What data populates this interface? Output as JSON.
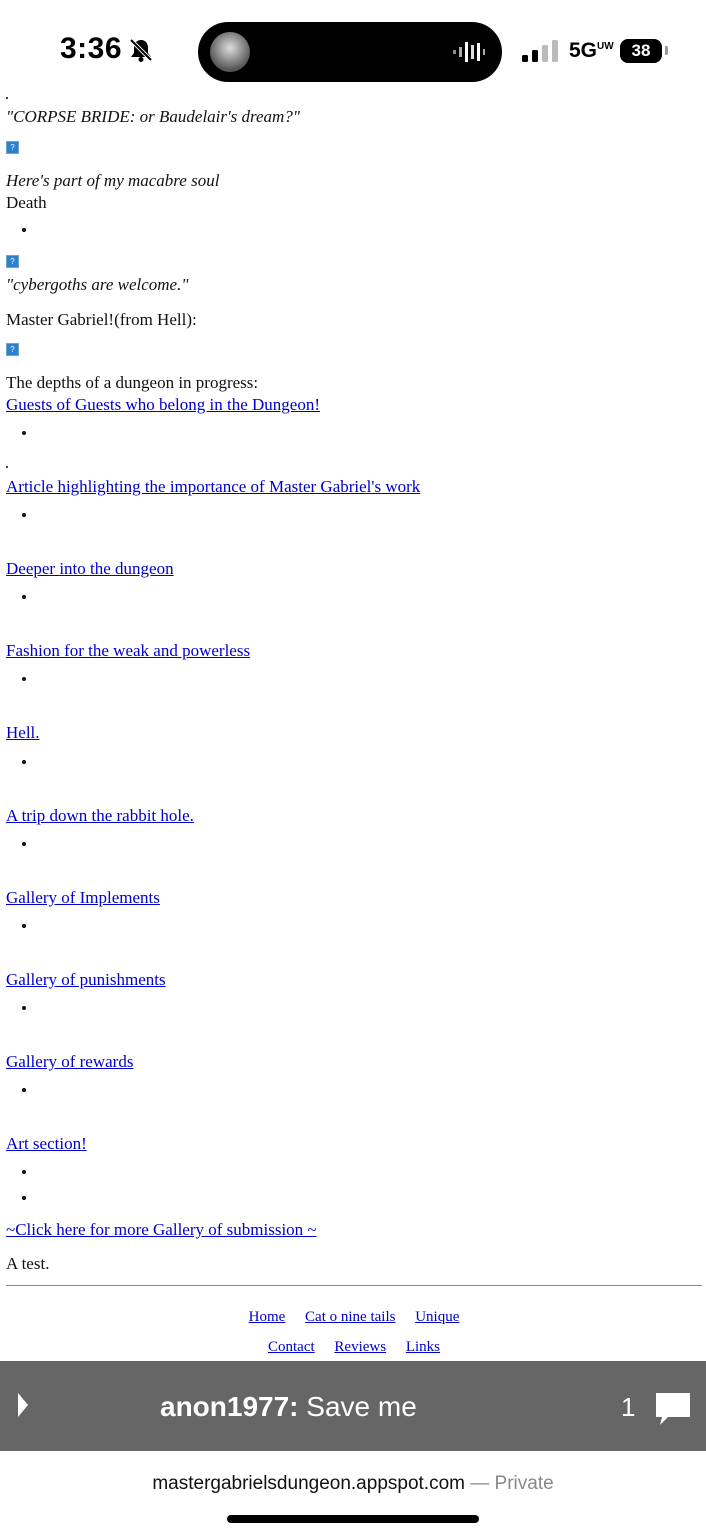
{
  "status_bar": {
    "time": "3:36",
    "network": "5G",
    "network_superscript": "UW",
    "battery": "38"
  },
  "content": {
    "corpse_bride": "\"CORPSE BRIDE: or Baudelair's dream?\"",
    "macabre_soul": "Here's part of my macabre soul",
    "death": "Death",
    "cybergoths": "\"cybergoths are welcome.\"",
    "master_gabriel": "Master Gabriel!(from Hell):",
    "dungeon_progress": "The depths of a dungeon in progress:",
    "links": [
      "Guests of Guests who belong in the Dungeon!",
      "Article highlighting the importance of Master Gabriel's work",
      "Deeper into the dungeon",
      "Fashion for the weak and powerless",
      "Hell.",
      "A trip down the rabbit hole.",
      "Gallery of Implements",
      "Gallery of punishments",
      "Gallery of rewards",
      "Art section!"
    ],
    "more_gallery": "~Click here for more Gallery of submission ~",
    "a_test": "A test.",
    "broken_image_glyph": "?"
  },
  "footer_nav": {
    "row1": [
      "Home",
      "Cat o nine tails",
      "Unique"
    ],
    "row2": [
      "Contact",
      "Reviews",
      "Links"
    ]
  },
  "chat_bar": {
    "user": "anon1977:",
    "message": "Save me",
    "count": "1"
  },
  "url_bar": {
    "domain": "mastergabrielsdungeon.appspot.com",
    "separator": "—",
    "mode": "Private"
  }
}
